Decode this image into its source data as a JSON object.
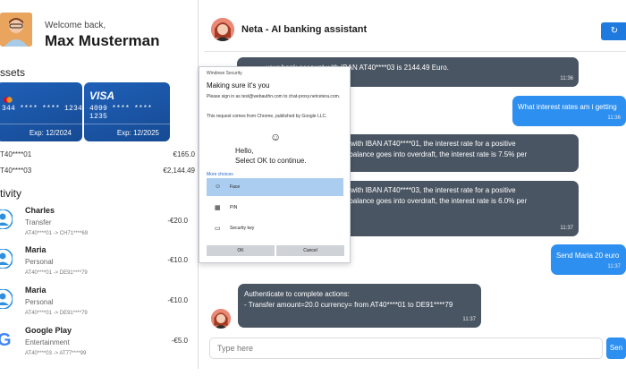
{
  "header": {
    "welcome": "Welcome back,",
    "user_name": "Max Musterman"
  },
  "assets": {
    "title": "ssets",
    "cards": [
      {
        "number": "344 **** **** 1234",
        "expiry": "Exp: 12/2024",
        "brand": ""
      },
      {
        "number": "4099 **** **** 1235",
        "expiry": "Exp: 12/2025",
        "brand": "VISA"
      }
    ],
    "accounts": [
      {
        "iban": "T40****01",
        "balance": "€165.0"
      },
      {
        "iban": "T40****03",
        "balance": "€2,144.49"
      }
    ]
  },
  "activity": {
    "title": "tivity",
    "items": [
      {
        "name": "Charles",
        "category": "Transfer",
        "route": "AT40****01 -> CH71****69",
        "amount": "-€20.0",
        "icon": "person-icon"
      },
      {
        "name": "Maria",
        "category": "Personal",
        "route": "AT40****01 -> DE91****79",
        "amount": "-€10.0",
        "icon": "person-icon"
      },
      {
        "name": "Maria",
        "category": "Personal",
        "route": "AT40****01 -> DE91****79",
        "amount": "-€10.0",
        "icon": "person-icon"
      },
      {
        "name": "Google Play",
        "category": "Entertainment",
        "route": "AT40****03 -> AT77****99",
        "amount": "-€5.0",
        "icon": "google-icon"
      }
    ]
  },
  "chat": {
    "title": "Neta - AI banking assistant",
    "refresh_icon": "↻",
    "messages": [
      {
        "role": "bot",
        "text": "your bank account with IBAN AT40****03 is 2144.49 Euro.",
        "time": "11:36"
      },
      {
        "role": "user",
        "text": "What interest rates am i getting",
        "time": "11:36"
      },
      {
        "role": "bot",
        "text": "ed with IBAN AT40****01, the interest rate for a positive\nur balance goes into overdraft, the interest rate is 7.5% per",
        "time": ""
      },
      {
        "role": "bot",
        "text": "ed with IBAN AT40****03, the interest rate for a positive\nur balance goes into overdraft, the interest rate is 6.0% per",
        "time": "11:37"
      },
      {
        "role": "user",
        "text": "Send Maria 20 euro",
        "time": "11:37"
      },
      {
        "role": "bot",
        "text": "Authenticate to complete actions:\n- Transfer amount=20.0 currency= from AT40****01 to DE91****79",
        "time": "11:37"
      }
    ],
    "input_placeholder": "Type here",
    "send_label": "Sen"
  },
  "dialog": {
    "window_title": "Windows Security",
    "heading": "Making sure it's you",
    "line1": "Please sign in as test@webauthn.com to chat-proxy.netcetera.com.",
    "line2": "This request comes from Chrome, published by Google LLC.",
    "face": "☺",
    "hello": "Hello,\nSelect OK to continue.",
    "more_choices": "More choices",
    "options": [
      {
        "label": "Face",
        "icon": "☺",
        "selected": true
      },
      {
        "label": "PIN",
        "icon": "▦",
        "selected": false
      },
      {
        "label": "Security key",
        "icon": "▭",
        "selected": false
      }
    ],
    "ok_label": "OK",
    "cancel_label": "Cancel"
  }
}
